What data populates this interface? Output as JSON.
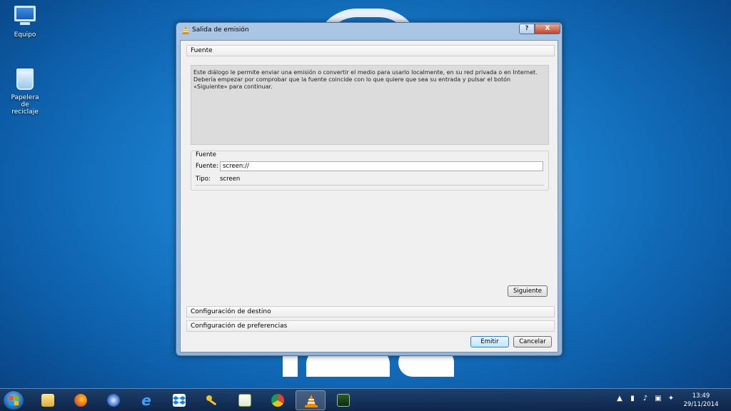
{
  "desktop": {
    "icons": [
      {
        "label": "Equipo"
      },
      {
        "label": "Papelera de reciclaje"
      }
    ]
  },
  "window": {
    "title": "Salida de emisión",
    "help_label": "?",
    "close_label": "X",
    "sections": {
      "source": "Fuente",
      "destination": "Configuración de destino",
      "preferences": "Configuración de preferencias"
    },
    "description": {
      "line1": "Este diálogo le permite enviar una emisión o convertir el medio para usarlo localmente, en su red privada o en Internet.",
      "line2": "Debería empezar por comprobar que la fuente coincide con lo que quiere que sea su entrada y pulsar el botón «Siguiente» para continuar."
    },
    "source_group": {
      "legend": "Fuente",
      "source_label": "Fuente:",
      "source_value": "screen://",
      "type_label": "Tipo:",
      "type_value": "screen"
    },
    "buttons": {
      "next": "Siguiente",
      "stream": "Emitir",
      "cancel": "Cancelar"
    }
  },
  "taskbar": {
    "apps": [
      "file-explorer",
      "firefox",
      "thunderbird",
      "internet-explorer",
      "dropbox",
      "keepass",
      "notepad",
      "chrome",
      "vlc",
      "system-monitor"
    ],
    "active_app": "vlc",
    "clock": {
      "time": "13:49",
      "date": "29/11/2014"
    }
  },
  "colors": {
    "desktop": "#1a7fce",
    "window_frame": "#9bbbe0",
    "close_button": "#c4452b",
    "default_button": "#bee6fd"
  }
}
